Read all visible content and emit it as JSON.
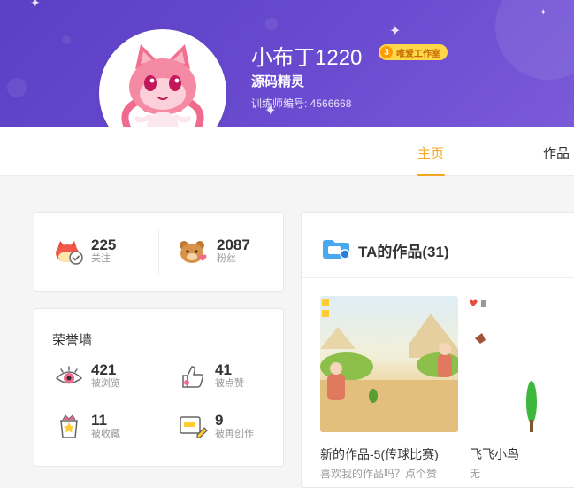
{
  "profile": {
    "username": "小布丁1220",
    "badge_level": "3",
    "badge_text": "唯爱工作室",
    "role": "源码精灵",
    "trainer_id": "训练师编号: 4566668"
  },
  "nav": {
    "tabs": [
      {
        "label": "主页",
        "active": true
      },
      {
        "label": "作品",
        "active": false
      }
    ]
  },
  "stats": {
    "following": {
      "count": "225",
      "label": "关注",
      "icon": "cat-heart-check-icon"
    },
    "fans": {
      "count": "2087",
      "label": "粉丝",
      "icon": "bear-heart-icon"
    }
  },
  "honor_wall": {
    "title": "荣誉墙",
    "items": [
      {
        "count": "421",
        "label": "被浏览",
        "icon": "eye-icon"
      },
      {
        "count": "41",
        "label": "被点赞",
        "icon": "thumbs-up-icon"
      },
      {
        "count": "11",
        "label": "被收藏",
        "icon": "star-box-icon"
      },
      {
        "count": "9",
        "label": "被再创作",
        "icon": "remix-pencil-icon"
      }
    ]
  },
  "works": {
    "title": "TA的作品(31)",
    "items": [
      {
        "title": "新的作品-5(传球比赛)",
        "desc": "喜欢我的作品吗？点个赞"
      },
      {
        "title": "飞飞小鸟",
        "desc": "无"
      }
    ]
  },
  "colors": {
    "banner": "#5b3fc4",
    "accent": "#f5a623",
    "badge": "#ffd84a"
  }
}
